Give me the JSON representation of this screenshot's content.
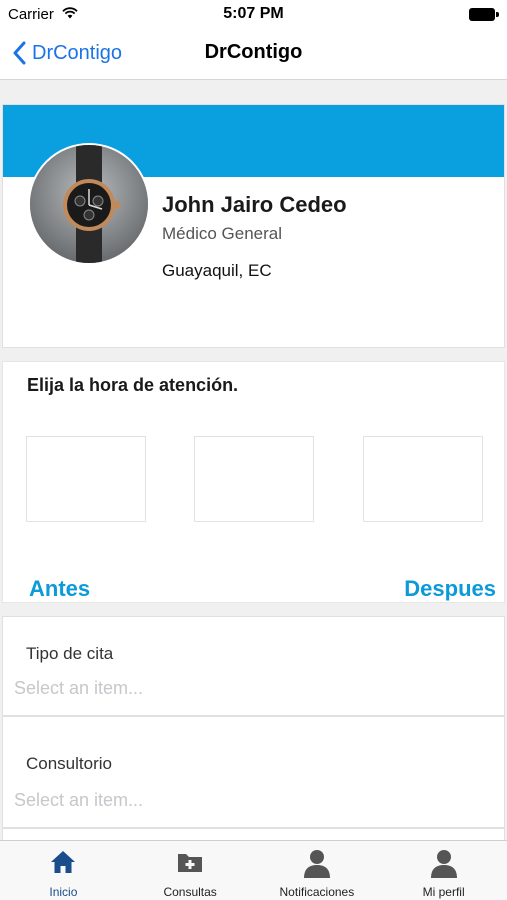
{
  "status_bar": {
    "carrier": "Carrier",
    "time": "5:07 PM"
  },
  "nav": {
    "back_label": "DrContigo",
    "title": "DrContigo"
  },
  "profile": {
    "name": "John Jairo Cedeo",
    "specialty": "Médico General",
    "city": "Guayaquil, EC"
  },
  "schedule": {
    "heading": "Elija la hora de atención.",
    "slots": [
      "",
      "",
      ""
    ],
    "prev_label": "Antes",
    "next_label": "Despues"
  },
  "form": {
    "appointment_type": {
      "label": "Tipo de cita",
      "placeholder": "Select an item..."
    },
    "office": {
      "label": "Consultorio",
      "placeholder": "Select an item..."
    }
  },
  "tabs": [
    {
      "label": "Inicio",
      "icon": "home-icon",
      "active": true
    },
    {
      "label": "Consultas",
      "icon": "folder-plus-icon",
      "active": false
    },
    {
      "label": "Notificaciones",
      "icon": "user-icon",
      "active": false
    },
    {
      "label": "Mi perfil",
      "icon": "user-icon",
      "active": false
    }
  ],
  "colors": {
    "accent": "#0aa0e0",
    "link": "#0d9ad8",
    "nav_tint": "#1a73e8",
    "tab_active": "#1a4d8c",
    "tab_icon": "#555555"
  }
}
